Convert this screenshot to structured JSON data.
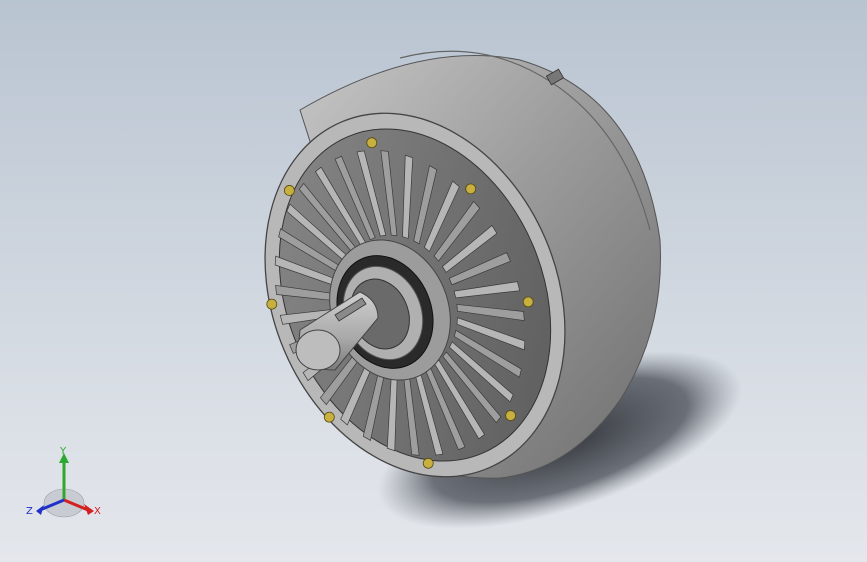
{
  "triad": {
    "x_label": "X",
    "y_label": "Y",
    "z_label": "Z",
    "x_color": "#d42020",
    "y_color": "#2ea82e",
    "z_color": "#2030c8"
  },
  "colors": {
    "background_top": "#b9c4d1",
    "background_bottom": "#e4e7ec",
    "housing": "#9a9a9a",
    "fins": "#a8a8a8",
    "shaft": "#b4b4b4",
    "bolt_accent": "#c8b040"
  }
}
